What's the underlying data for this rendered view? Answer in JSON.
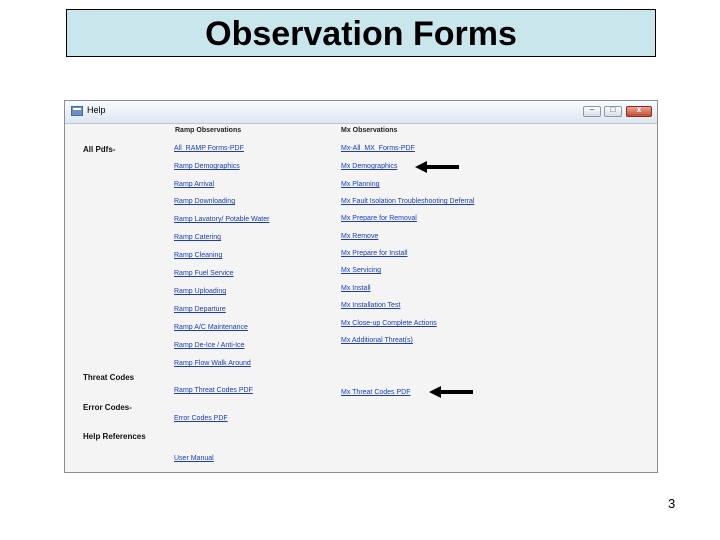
{
  "slide": {
    "title": "Observation Forms",
    "page_number": "3"
  },
  "window": {
    "title": "Help",
    "controls": {
      "minimize": "–",
      "maximize": "□",
      "close": "x"
    }
  },
  "columns": {
    "ramp": "Ramp Observations",
    "mx": "Mx Observations"
  },
  "row_labels": {
    "all_pdfs": "All Pdfs-",
    "threat_codes": "Threat Codes",
    "error_codes": "Error Codes-",
    "help_references": "Help References"
  },
  "ramp_links": [
    "All_RAMP Forms-PDF",
    "Ramp Demographics",
    "Ramp Arrival",
    "Ramp Downloading",
    "Ramp Lavatory/ Potable Water",
    "Ramp Catering",
    "Ramp Cleaning",
    "Ramp Fuel Service",
    "Ramp Uploading",
    "Ramp Departure",
    "Ramp A/C Maintenance",
    "Ramp De-Ice / Anti-Ice",
    "Ramp Flow Walk Around"
  ],
  "mx_links": [
    "Mx-All_MX_Forms-PDF",
    "Mx Demographics",
    "Mx Planning",
    "Mx Fault Isolation Troubleshooting Deferral",
    "Mx Prepare for Removal",
    "Mx Remove",
    "Mx Prepare for Install",
    "Mx Servicing",
    "Mx Install",
    "Mx Installation Test",
    "Mx Close-up Complete Actions",
    "Mx Additional Threat(s)"
  ],
  "threat_links": {
    "ramp": "Ramp Threat Codes PDF",
    "mx": "Mx Threat Codes PDF"
  },
  "error_link": "Error Codes PDF",
  "help_link": "User Manual"
}
